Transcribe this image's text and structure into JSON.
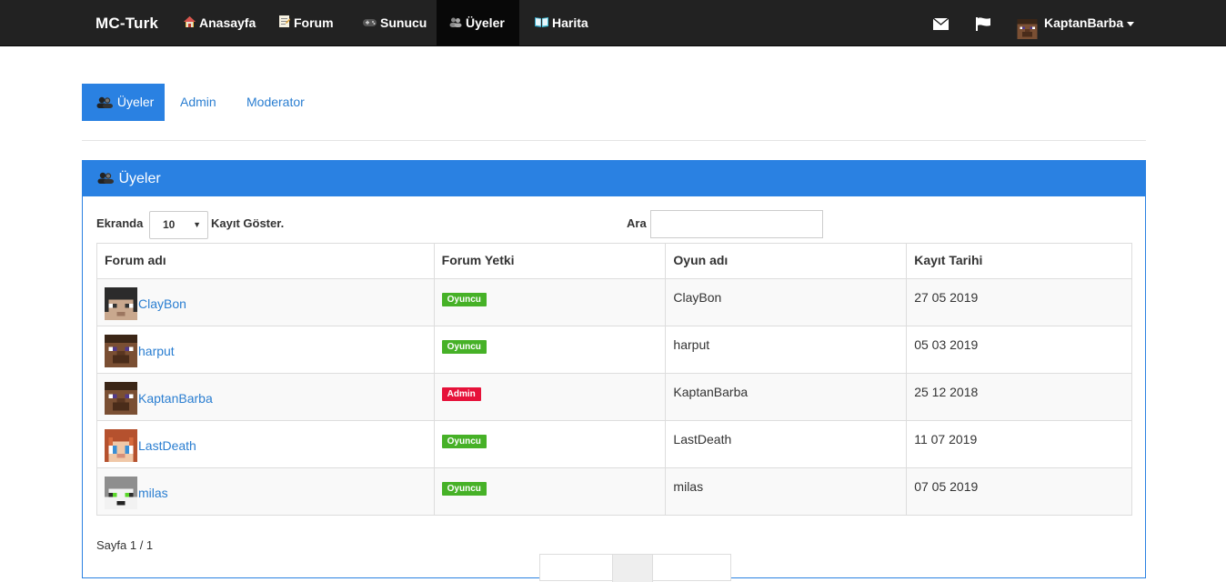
{
  "navbar": {
    "brand": "MC-Turk",
    "items": [
      {
        "label": "Anasayfa",
        "icon": "house-icon"
      },
      {
        "label": "Forum",
        "icon": "memo-icon"
      },
      {
        "label": "Sunucu",
        "icon": "gamepad-icon"
      },
      {
        "label": "Üyeler",
        "icon": "users-icon",
        "active": true
      },
      {
        "label": "Harita",
        "icon": "book-icon"
      }
    ],
    "user": {
      "name": "KaptanBarba"
    }
  },
  "tabs": [
    {
      "label": "Üyeler",
      "active": true
    },
    {
      "label": "Admin"
    },
    {
      "label": "Moderator"
    }
  ],
  "panel": {
    "title": "Üyeler",
    "show_label_prefix": "Ekranda",
    "show_value": "10",
    "show_label_suffix": "Kayıt Göster.",
    "search_label": "Ara",
    "search_value": ""
  },
  "table": {
    "headers": [
      "Forum adı",
      "Forum Yetki",
      "Oyun adı",
      "Kayıt Tarihi"
    ],
    "rows": [
      {
        "forum_name": "ClayBon",
        "role": "Oyuncu",
        "game_name": "ClayBon",
        "date": "27 05 2019"
      },
      {
        "forum_name": "harput",
        "role": "Oyuncu",
        "game_name": "harput",
        "date": "05 03 2019"
      },
      {
        "forum_name": "KaptanBarba",
        "role": "Admin",
        "game_name": "KaptanBarba",
        "date": "25 12 2018"
      },
      {
        "forum_name": "LastDeath",
        "role": "Oyuncu",
        "game_name": "LastDeath",
        "date": "11 07 2019"
      },
      {
        "forum_name": "milas",
        "role": "Oyuncu",
        "game_name": "milas",
        "date": "07 05 2019"
      }
    ]
  },
  "footer": {
    "page_info": "Sayfa 1 / 1"
  },
  "colors": {
    "accent": "#2a81e2",
    "navbar_bg": "#222222",
    "role_player": "#46b127",
    "role_admin": "#e6123a",
    "link": "#2a7ed1"
  }
}
